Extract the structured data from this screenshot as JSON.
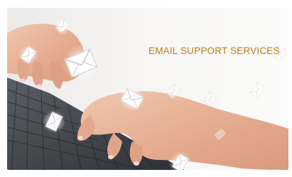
{
  "image": {
    "headline": "EMAIL SUPPORT SERVICES",
    "colors": {
      "background": "#f5f5f4",
      "headline": "#c27a18",
      "skin": "#e6b59c",
      "keyboard": "#3a3d44",
      "envelope": "#ffffff"
    },
    "icons": [
      "envelope-icon"
    ]
  }
}
